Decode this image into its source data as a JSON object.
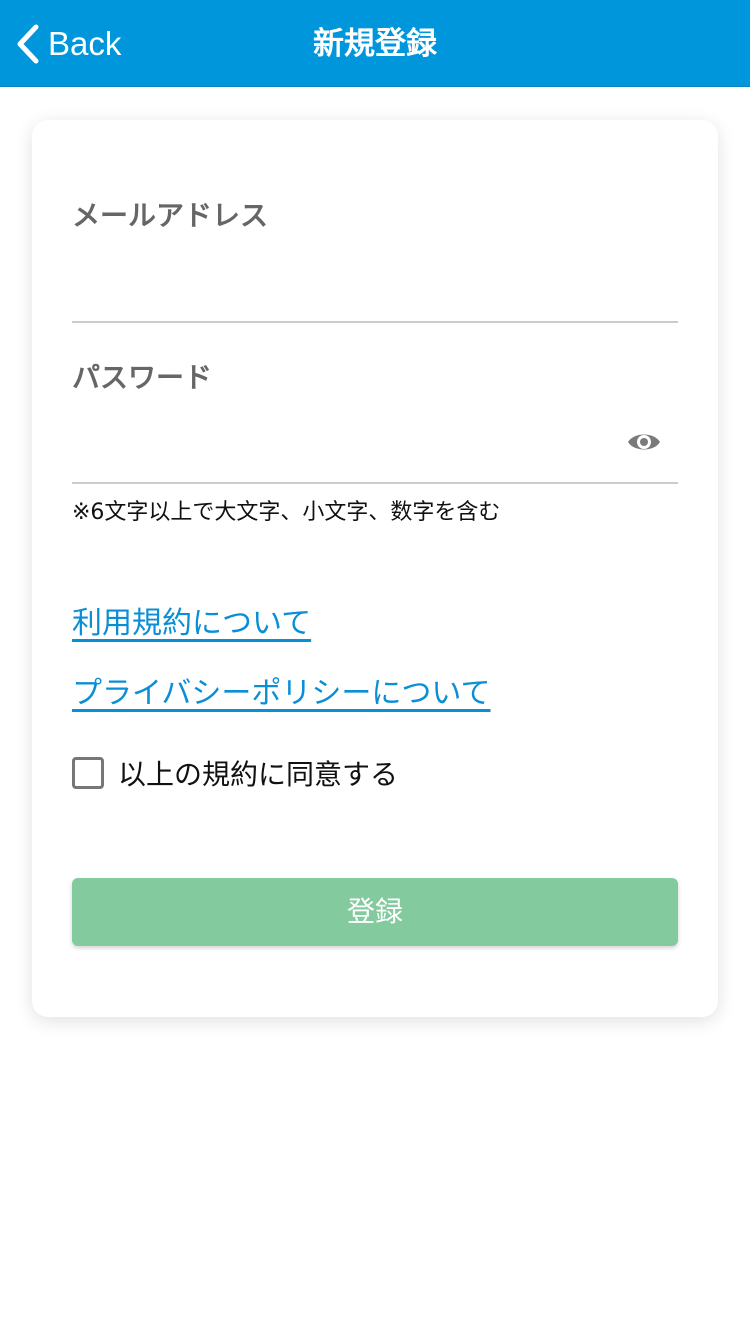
{
  "header": {
    "back_label": "Back",
    "title": "新規登録",
    "background_color": "#0096dc"
  },
  "form": {
    "email": {
      "label": "メールアドレス",
      "value": "",
      "placeholder": ""
    },
    "password": {
      "label": "パスワード",
      "value": "",
      "placeholder": "",
      "visibility_icon": "eye-icon",
      "hint": "※6文字以上で大文字、小文字、数字を含む"
    },
    "links": {
      "terms": "利用規約について",
      "privacy": "プライバシーポリシーについて",
      "color": "#0a8fd6"
    },
    "agreement": {
      "label": "以上の規約に同意する",
      "checked": false
    },
    "submit": {
      "label": "登録",
      "color": "#83cb9e"
    }
  }
}
